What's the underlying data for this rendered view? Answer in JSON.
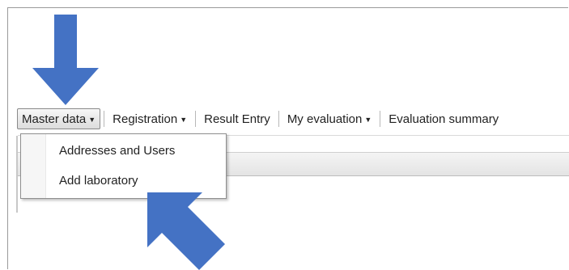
{
  "menubar": {
    "items": [
      {
        "label": "Master data",
        "has_caret": true,
        "active": true
      },
      {
        "label": "Registration",
        "has_caret": true,
        "active": false
      },
      {
        "label": "Result Entry",
        "has_caret": false,
        "active": false
      },
      {
        "label": "My evaluation",
        "has_caret": true,
        "active": false
      },
      {
        "label": "Evaluation summary",
        "has_caret": false,
        "active": false
      }
    ],
    "caret_glyph": "▼"
  },
  "dropdown": {
    "items": [
      {
        "label": "Addresses and Users"
      },
      {
        "label": "Add laboratory"
      }
    ]
  },
  "annotations": {
    "arrow_color": "#4472c4",
    "arrows": [
      "down-arrow-icon",
      "up-left-arrow-icon"
    ]
  }
}
